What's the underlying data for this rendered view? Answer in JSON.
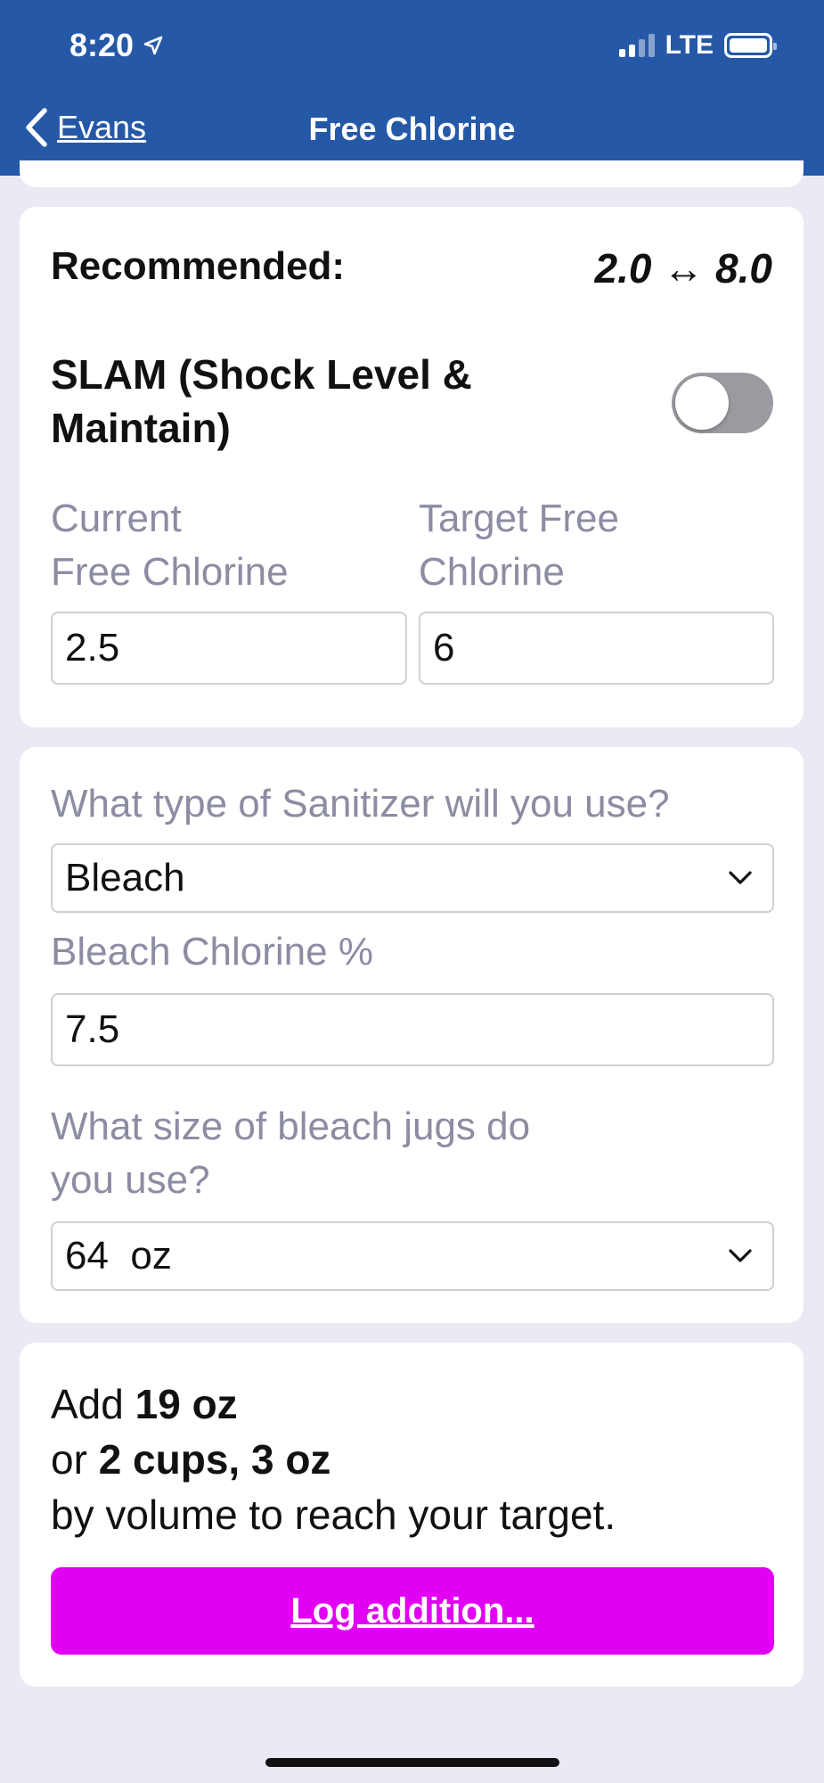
{
  "status": {
    "time": "8:20",
    "network": "LTE"
  },
  "nav": {
    "back_label": "Evans",
    "title": "Free Chlorine"
  },
  "recommended": {
    "label": "Recommended:",
    "value": "2.0 ↔ 8.0"
  },
  "slam": {
    "label": "SLAM (Shock Level & Maintain)",
    "enabled": false
  },
  "current_fc": {
    "label_line1": "Current",
    "label_line2": "Free Chlorine",
    "value": "2.5"
  },
  "target_fc": {
    "label_line1": "Target Free",
    "label_line2": "Chlorine",
    "value": "6"
  },
  "sanitizer": {
    "question": "What type of Sanitizer will you use?",
    "selected": "Bleach"
  },
  "bleach_pct": {
    "label": "Bleach Chlorine %",
    "value": "7.5"
  },
  "jug_size": {
    "question_line1": "What size of bleach jugs do",
    "question_line2": "you use?",
    "selected": "64  oz"
  },
  "result": {
    "prefix1": "Add ",
    "amount_oz": "19 oz",
    "prefix2": "or ",
    "amount_cups": "2 cups, 3 oz",
    "suffix": "by volume to reach your target."
  },
  "log_button": "Log addition..."
}
